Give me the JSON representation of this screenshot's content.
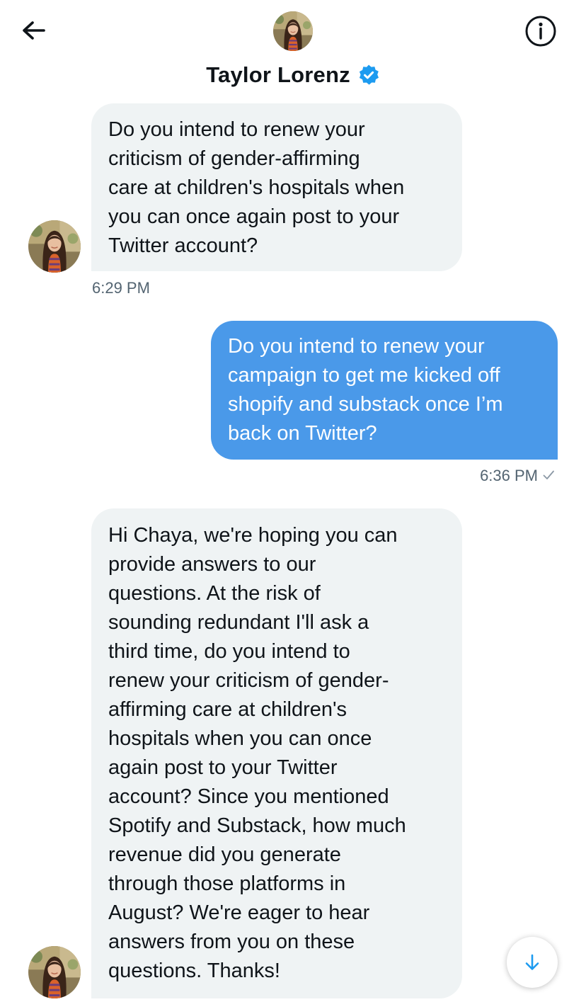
{
  "header": {
    "name": "Taylor Lorenz",
    "back_icon": "arrow-left-icon",
    "info_icon": "info-circle-icon",
    "verified_icon": "verified-badge-icon",
    "accent_color": "#1d9bf0"
  },
  "messages": [
    {
      "direction": "incoming",
      "text": "Do you intend to renew your\ncriticism of gender-affirming\ncare at children's hospitals when\nyou can once again post to your\nTwitter account?",
      "time": "6:29 PM"
    },
    {
      "direction": "outgoing",
      "text": "Do you intend to renew your\ncampaign to get me kicked off\nshopify and substack once I’m\nback on Twitter?",
      "time": "6:36 PM",
      "status_icon": "sent-check-icon"
    },
    {
      "direction": "incoming",
      "text": "Hi Chaya, we're hoping you can\nprovide answers to our\nquestions. At the risk of\nsounding redundant I'll ask a\nthird time, do you intend to\nrenew your criticism of gender-\naffirming care at children's\nhospitals when you can once\nagain post to your Twitter\naccount? Since you mentioned\nSpotify and Substack, how much\nrevenue did you generate\nthrough those platforms in\nAugust? We're eager to hear\nanswers from you on these\nquestions. Thanks!"
    }
  ],
  "colors": {
    "incoming_bubble": "#eff3f4",
    "outgoing_bubble": "#4a99e9",
    "timestamp": "#536471"
  },
  "scroll_button_icon": "arrow-down-icon"
}
